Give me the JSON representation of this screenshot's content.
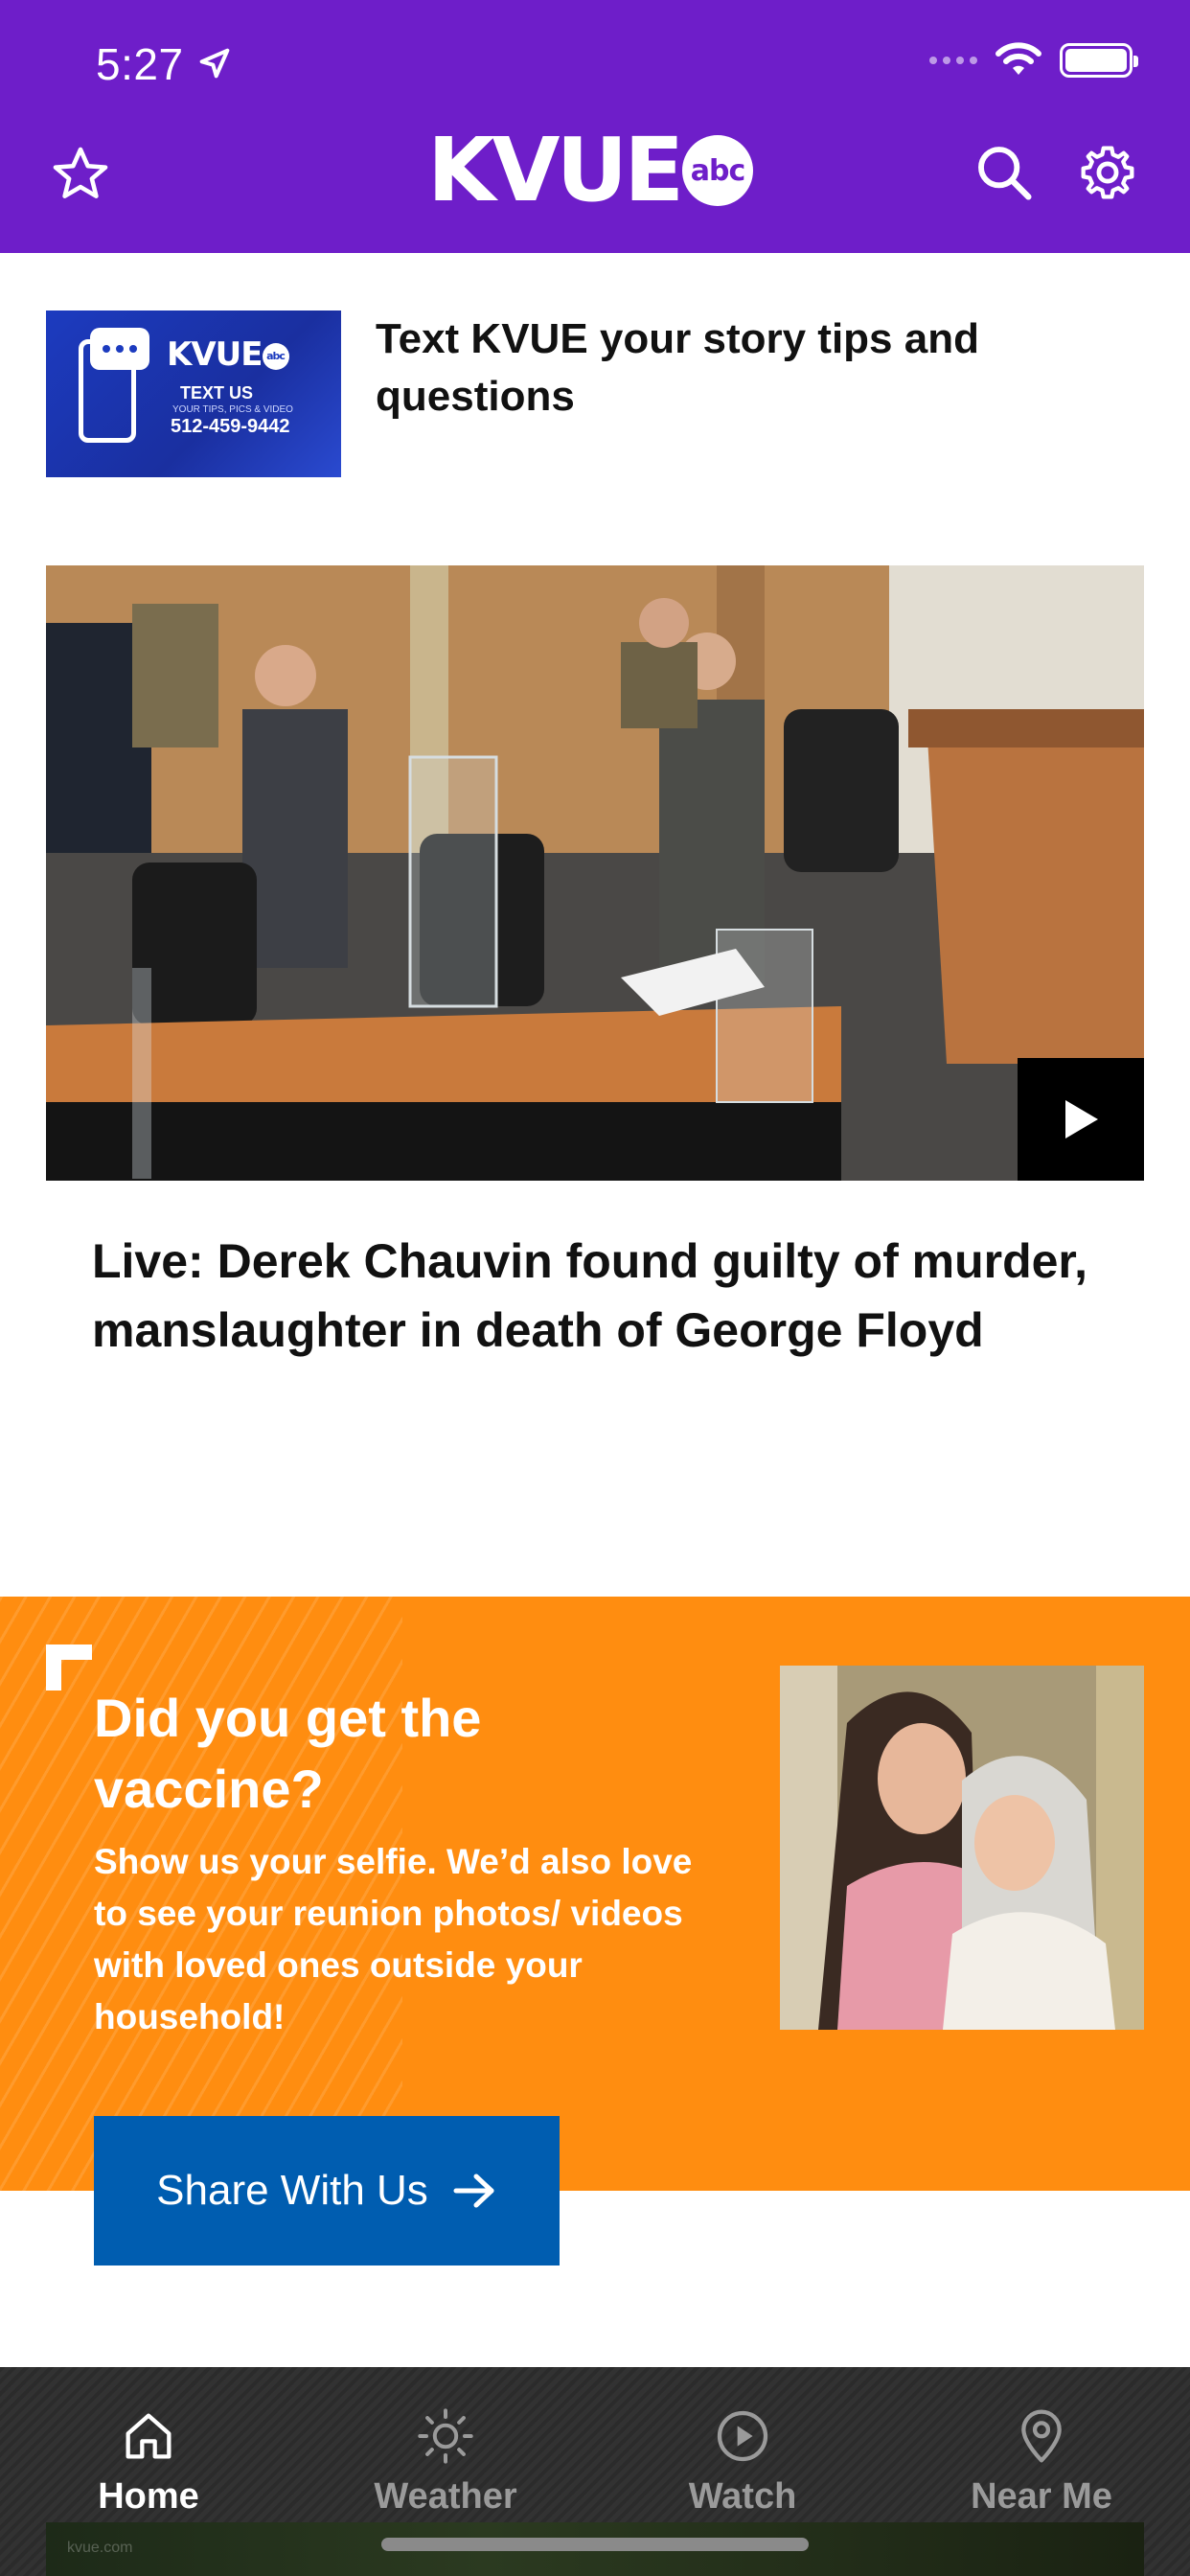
{
  "status_bar": {
    "time": "5:27"
  },
  "header": {
    "brand": "KVUE",
    "brand_badge": "abc"
  },
  "tip": {
    "thumb": {
      "brand": "KVUE",
      "badge": "abc",
      "line1": "TEXT US",
      "line2": "YOUR TIPS, PICS & VIDEO",
      "phone": "512-459-9442"
    },
    "title": "Text KVUE your story tips and questions"
  },
  "hero": {
    "title": "Live: Derek Chauvin found guilty of murder, manslaughter in death of George Floyd"
  },
  "promo": {
    "title": "Did you get the vaccine?",
    "body": "Show us your selfie. We’d also love to see your reunion photos/ videos with loved ones outside your household!",
    "button_label": "Share With Us"
  },
  "tabs": [
    {
      "label": "Home",
      "icon": "home-icon",
      "active": true
    },
    {
      "label": "Weather",
      "icon": "sun-icon",
      "active": false
    },
    {
      "label": "Watch",
      "icon": "play-circle-icon",
      "active": false
    },
    {
      "label": "Near Me",
      "icon": "location-pin-icon",
      "active": false
    }
  ],
  "bottom_strip": {
    "text": "kvue.com"
  },
  "colors": {
    "header_bg": "#6e1ec9",
    "promo_bg": "#ff8d10",
    "button_bg": "#005db0",
    "tabbar_bg": "#2e2e2e"
  }
}
